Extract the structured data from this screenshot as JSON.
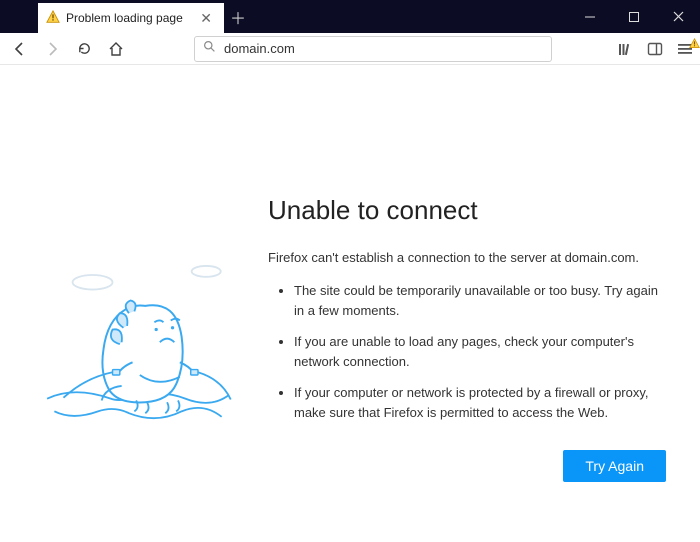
{
  "tab": {
    "title": "Problem loading page"
  },
  "urlbar": {
    "value": "domain.com"
  },
  "page": {
    "heading": "Unable to connect",
    "subhead": "Firefox can't establish a connection to the server at domain.com.",
    "bullets": [
      "The site could be temporarily unavailable or too busy. Try again in a few moments.",
      "If you are unable to load any pages, check your computer's network connection.",
      "If your computer or network is protected by a firewall or proxy, make sure that Firefox is permitted to access the Web."
    ],
    "try_again_label": "Try Again"
  }
}
